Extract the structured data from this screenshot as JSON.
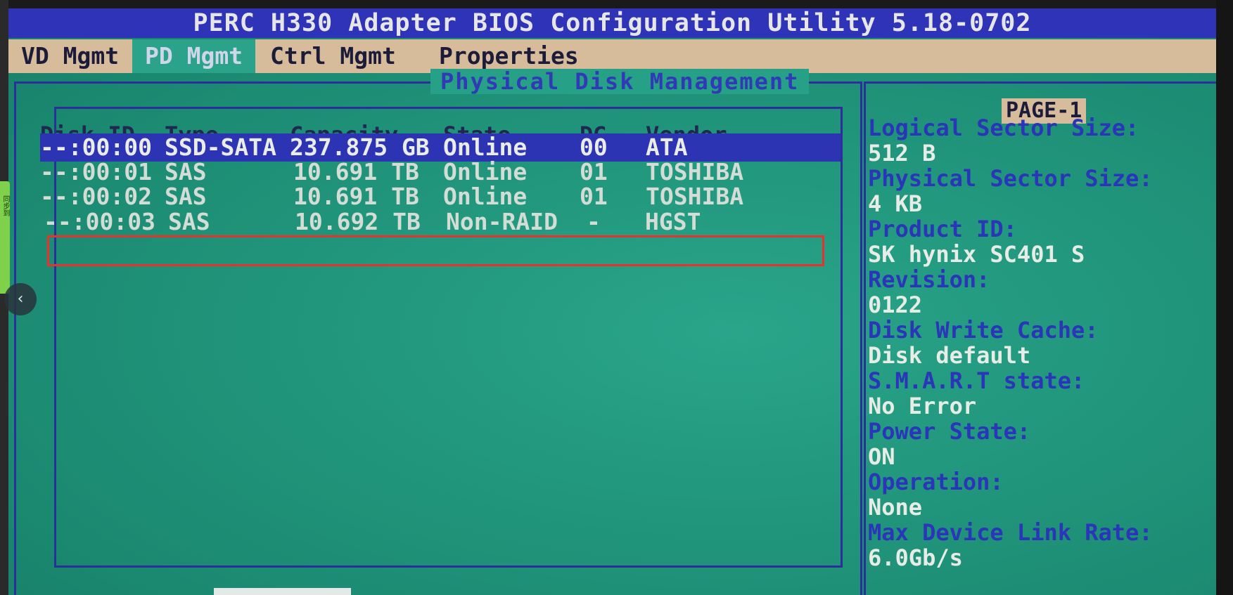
{
  "title": "PERC H330 Adapter BIOS Configuration Utility 5.18-0702",
  "side_tab_text": "同步到",
  "nav_arrow": "‹",
  "menu": [
    {
      "label": "VD Mgmt"
    },
    {
      "label": "PD Mgmt"
    },
    {
      "label": "Ctrl Mgmt"
    },
    {
      "label": "Properties"
    }
  ],
  "panel_title": "Physical Disk Management",
  "columns": [
    "Disk ID",
    "Type",
    "Capacity",
    "State",
    "DG",
    "Vendor"
  ],
  "disks": [
    {
      "id": "--:00:00",
      "type": "SSD-SATA",
      "capacity": "237.875 GB",
      "state": "Online",
      "dg": "00",
      "vendor": "ATA"
    },
    {
      "id": "--:00:01",
      "type": "SAS",
      "capacity": "10.691 TB",
      "state": "Online",
      "dg": "01",
      "vendor": "TOSHIBA"
    },
    {
      "id": "--:00:02",
      "type": "SAS",
      "capacity": "10.691 TB",
      "state": "Online",
      "dg": "01",
      "vendor": "TOSHIBA"
    },
    {
      "id": "--:00:03",
      "type": "SAS",
      "capacity": "10.692 TB",
      "state": "Non-RAID",
      "dg": "-",
      "vendor": "HGST"
    }
  ],
  "page_label": "PAGE-1",
  "properties": [
    {
      "label": "Logical Sector Size:",
      "value": "512 B"
    },
    {
      "label": "Physical Sector Size:",
      "value": "4 KB"
    },
    {
      "label": "Product ID:",
      "value": "SK hynix SC401 S"
    },
    {
      "label": "Revision:",
      "value": "0122"
    },
    {
      "label": "Disk Write Cache:",
      "value": "Disk default"
    },
    {
      "label": "S.M.A.R.T state:",
      "value": "No Error"
    },
    {
      "label": "Power State:",
      "value": "ON"
    },
    {
      "label": "Operation:",
      "value": "None"
    },
    {
      "label": "Max Device Link Rate:",
      "value": "6.0Gb/s"
    }
  ],
  "colors": {
    "title_bar": "#2e33b8",
    "menu_bar": "#d7bc9b",
    "screen_bg": "#22987e",
    "selection": "#2d34b4",
    "highlight_box": "#e8322e",
    "label_text": "#2a35b8"
  }
}
